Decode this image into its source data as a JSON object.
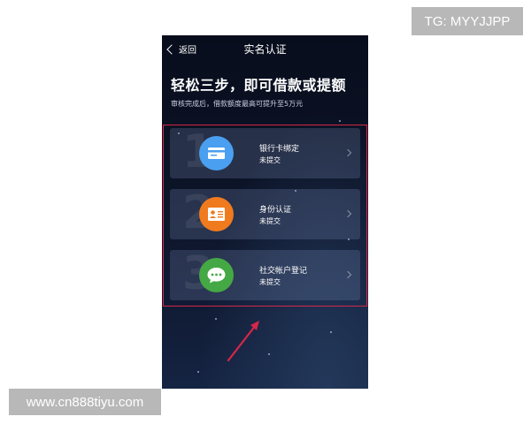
{
  "watermarks": {
    "top": "TG: MYYJJPP",
    "bottom": "www.cn888tiyu.com"
  },
  "nav": {
    "back_label": "返回",
    "title": "实名认证"
  },
  "headline": "轻松三步，即可借款或提额",
  "subline": "审核完成后，借款额度最高可提升至5万元",
  "cards": [
    {
      "title": "银行卡绑定",
      "status": "未提交",
      "icon": "bank-card-icon",
      "color": "#4a9ff0"
    },
    {
      "title": "身份认证",
      "status": "未提交",
      "icon": "id-card-icon",
      "color": "#f07a1e"
    },
    {
      "title": "社交帐户登记",
      "status": "未提交",
      "icon": "chat-bubble-icon",
      "color": "#44a844"
    }
  ],
  "colors": {
    "highlight_border": "#d6264a",
    "annotation_arrow": "#d6264a"
  }
}
